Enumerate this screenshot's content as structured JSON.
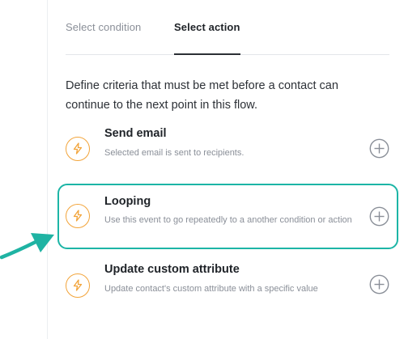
{
  "tabs": [
    {
      "label": "Select condition",
      "active": false
    },
    {
      "label": "Select action",
      "active": true
    }
  ],
  "description": "Define criteria that must be met before a contact can continue to the next point in this flow.",
  "actions": [
    {
      "title": "Send email",
      "description": "Selected email is sent to recipients.",
      "icon": "lightning-icon",
      "highlighted": false
    },
    {
      "title": "Looping",
      "description": "Use this event to go repeatedly to a another condition or action",
      "icon": "lightning-icon",
      "highlighted": true
    },
    {
      "title": "Update custom attribute",
      "description": "Update contact's custom attribute with a specific value",
      "icon": "lightning-icon",
      "highlighted": false
    }
  ],
  "add_icon": "plus-circle-icon",
  "colors": {
    "accent_orange": "#f2a43a",
    "highlight_teal": "#1cb5a6",
    "arrow_teal": "#1fb3a3",
    "muted_text": "#8a8f98",
    "primary_text": "#1f2328"
  }
}
